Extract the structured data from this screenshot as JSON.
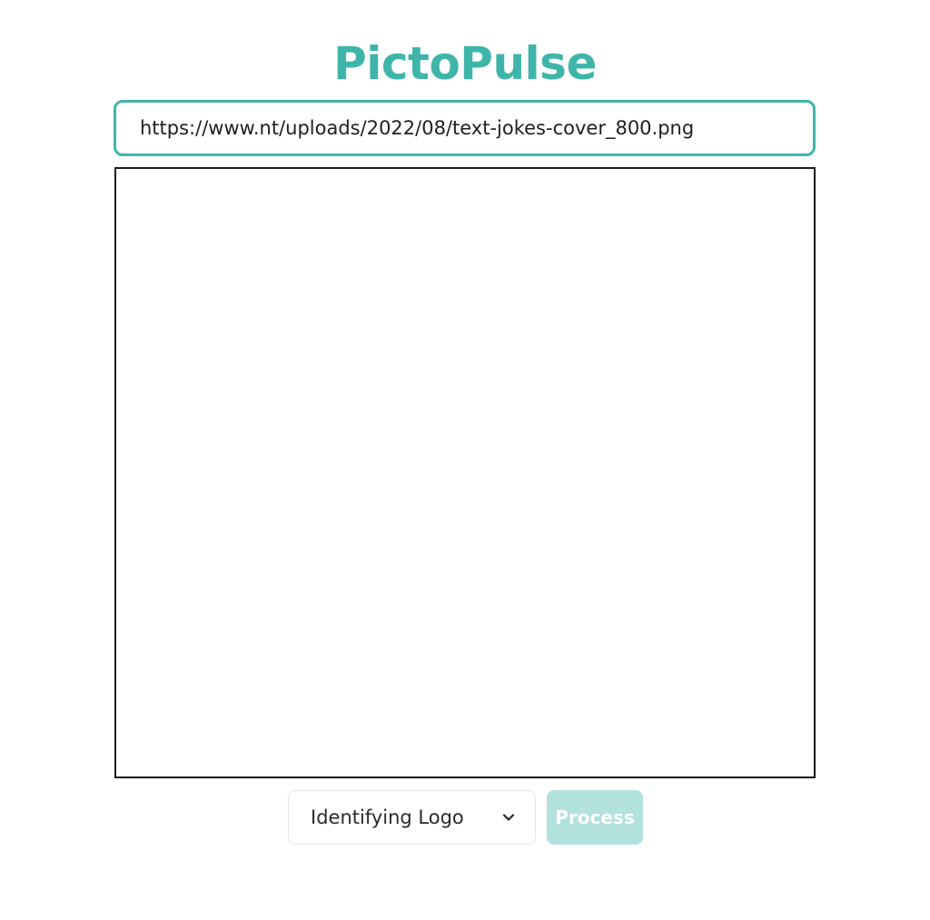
{
  "app": {
    "title": "PictoPulse"
  },
  "url_input": {
    "value": "https://www.nt/uploads/2022/08/text-jokes-cover_800.png"
  },
  "controls": {
    "mode_select": {
      "selected": "Identifying Logo",
      "icon": "chevron-down-icon"
    },
    "process_label": "Process",
    "process_enabled": false
  },
  "colors": {
    "accent": "#3fb5aa",
    "button_disabled": "#b2e1de",
    "preview_border": "#1a1a1a"
  }
}
